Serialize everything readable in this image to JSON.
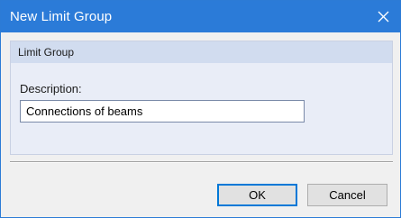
{
  "window": {
    "title": "New Limit Group",
    "close_icon": "close-icon",
    "accent_color": "#2b7bd8"
  },
  "group": {
    "header": "Limit Group",
    "description_label": "Description:",
    "description_value": "Connections of beams"
  },
  "buttons": {
    "ok_label": "OK",
    "cancel_label": "Cancel"
  }
}
